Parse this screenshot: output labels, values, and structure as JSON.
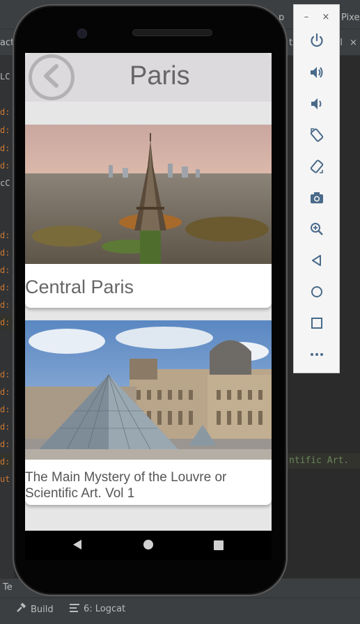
{
  "ide": {
    "top_right_tabs": [
      "p",
      "Pixe"
    ],
    "tab_row": [
      "act",
      "ty",
      "nl"
    ],
    "close_glyph": "×",
    "code_snippet": "ntific Art.",
    "left_fragments": [
      "LC",
      "cC",
      "ut"
    ],
    "gutter_marks": [
      "d:",
      "d:",
      "d:",
      "d:",
      "d:",
      "d:",
      "d:",
      "d:",
      "d:",
      "d:",
      "d:",
      "d:",
      "d:",
      "d:",
      "d:",
      "d:",
      "d:"
    ],
    "bottom_strip_text": "Te",
    "status_build": "Build",
    "status_logcat": "6: Logcat"
  },
  "app": {
    "title": "Paris",
    "cards": [
      {
        "caption": "Central Paris"
      },
      {
        "caption": "The Main Mystery of the Louvre or Scientific Art. Vol 1"
      }
    ]
  },
  "emulator": {
    "minimize": "–",
    "close": "×",
    "buttons": [
      "power-icon",
      "volume-up-icon",
      "volume-down-icon",
      "rotate-left-icon",
      "rotate-right-icon",
      "camera-icon",
      "zoom-icon",
      "back-icon",
      "home-icon",
      "overview-icon",
      "more-icon"
    ]
  },
  "colors": {
    "ide_bg": "#2b2b2b",
    "app_header": "#dddadd",
    "screen_bg": "#e6e6e6",
    "text_gray": "#666666",
    "emulator_icon": "#4a6a8a"
  }
}
